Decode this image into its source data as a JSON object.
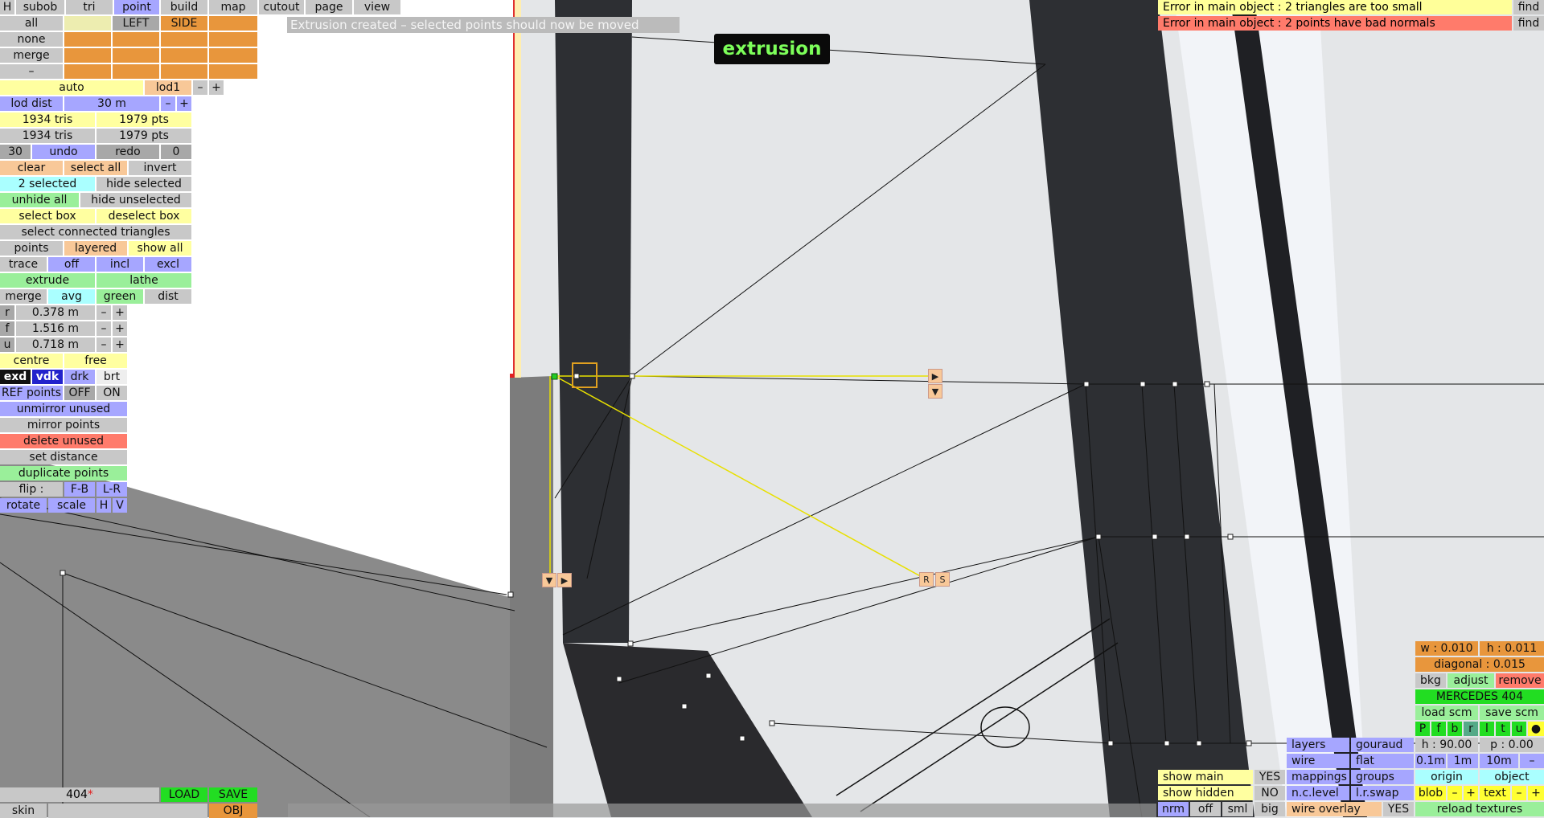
{
  "menu": [
    "H",
    "subob",
    "tri",
    "point",
    "build",
    "map",
    "cutout",
    "page",
    "view"
  ],
  "row_all": {
    "all": "all",
    "left": "LEFT",
    "side": "SIDE"
  },
  "row_none": "none",
  "row_merge": "merge",
  "row_dash": "–",
  "lod": {
    "auto": "auto",
    "level": "lod1",
    "minus": "–",
    "plus": "+"
  },
  "lod_dist": {
    "label": "lod dist",
    "value": "30 m",
    "minus": "–",
    "plus": "+"
  },
  "stats": {
    "tris": "1934 tris",
    "pts": "1979 pts"
  },
  "undo_row": {
    "count": "30",
    "undo": "undo",
    "redo": "redo",
    "redo_count": "0"
  },
  "select": {
    "clear": "clear",
    "select_all": "select all",
    "invert": "invert",
    "selected": "2 selected",
    "hide_selected": "hide selected",
    "unhide_all": "unhide all",
    "hide_unselected": "hide unselected",
    "select_box": "select box",
    "deselect_box": "deselect box",
    "connected": "select connected triangles"
  },
  "points_row": {
    "points": "points",
    "layered": "layered",
    "show_all": "show all"
  },
  "trace_row": {
    "trace": "trace",
    "off": "off",
    "incl": "incl",
    "excl": "excl"
  },
  "extrude_row": {
    "extrude": "extrude",
    "lathe": "lathe"
  },
  "merge_row": {
    "merge": "merge",
    "avg": "avg",
    "green": "green",
    "dist": "dist"
  },
  "coords": [
    {
      "axis": "r",
      "value": "0.378 m"
    },
    {
      "axis": "f",
      "value": "1.516 m"
    },
    {
      "axis": "u",
      "value": "0.718 m"
    }
  ],
  "coord_minus": "–",
  "coord_plus": "+",
  "centre_row": {
    "centre": "centre",
    "free": "free"
  },
  "mode_row": {
    "exd": "exd",
    "vdk": "vdk",
    "drk": "drk",
    "brt": "brt"
  },
  "ref_row": {
    "label": "REF points",
    "off": "OFF",
    "on": "ON"
  },
  "tools": {
    "unmirror": "unmirror unused",
    "mirror": "mirror points",
    "delete": "delete unused",
    "set_distance": "set distance",
    "duplicate": "duplicate points"
  },
  "flip_row": {
    "flip": "flip :",
    "fb": "F-B",
    "lr": "L-R"
  },
  "rotate_row": {
    "rotate": "rotate",
    "scale": "scale",
    "h": "H",
    "v": "V"
  },
  "status_msg": "Extrusion created – selected points should now be moved",
  "mode_label": "extrusion",
  "errors": [
    {
      "text": "Error in main object : 2 triangles are too small",
      "action": "find"
    },
    {
      "text": "Error in main object : 2 points have bad normals",
      "action": "find"
    }
  ],
  "file": {
    "name": "404",
    "mark": "*",
    "load": "LOAD",
    "save": "SAVE",
    "skin": "skin",
    "obj": "OBJ"
  },
  "handles": {
    "right": "▶",
    "down": "▼",
    "r": "R",
    "s": "S"
  },
  "right_panel": {
    "w": "w : 0.010",
    "h": "h : 0.011",
    "diagonal": "diagonal : 0.015",
    "bkg": "bkg",
    "adjust": "adjust",
    "remove": "remove",
    "model": "MERCEDES 404",
    "load_scm": "load scm",
    "save_scm": "save scm",
    "views": [
      "P",
      "f",
      "b",
      "r",
      "l",
      "t",
      "u",
      "●"
    ],
    "heading": "h : 90.00",
    "pitch": "p : 0.00",
    "grid": [
      "0.1m",
      "1m",
      "10m",
      "–"
    ],
    "origin": "origin",
    "object": "object",
    "blob": "blob",
    "text": "text",
    "minus": "–",
    "plus": "+",
    "reload": "reload textures"
  },
  "bottom_right": {
    "layers": "layers",
    "gouraud": "gouraud",
    "wire": "wire",
    "flat": "flat",
    "mappings": "mappings",
    "groups": "groups",
    "nc_level": "n.c.level",
    "lr_swap": "l.r.swap",
    "show_main": "show main",
    "show_main_val": "YES",
    "show_hidden": "show hidden",
    "show_hidden_val": "NO",
    "nrm": "nrm",
    "off": "off",
    "sml": "sml",
    "big": "big",
    "wire_overlay": "wire overlay",
    "wire_overlay_val": "YES"
  },
  "colors": {
    "selection": "#e8e000",
    "selected_point": "#22cc22",
    "mesh_dark": "#2d2f33",
    "background": "#e4e6e8"
  }
}
